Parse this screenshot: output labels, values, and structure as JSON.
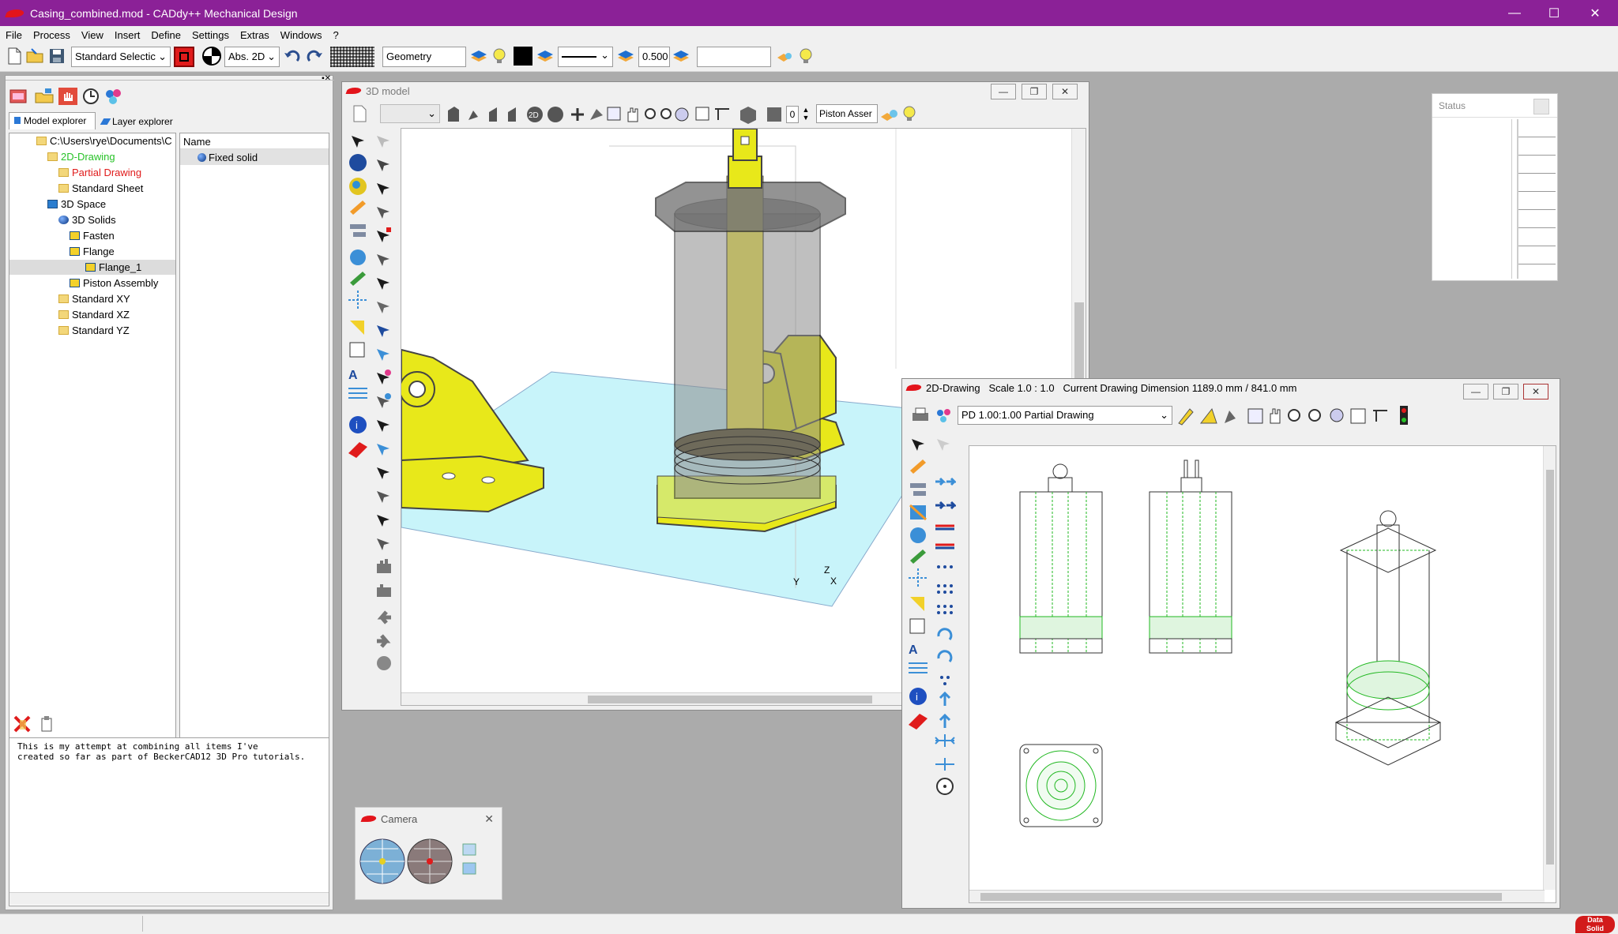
{
  "window": {
    "file_title": "Casing_combined.mod",
    "app_title": "CADdy++ Mechanical Design",
    "title_sep": "-",
    "controls": {
      "minimize": "—",
      "maximize": "☐",
      "close": "✕"
    }
  },
  "menu": [
    "File",
    "Process",
    "View",
    "Insert",
    "Define",
    "Settings",
    "Extras",
    "Windows",
    "?"
  ],
  "toolbar": {
    "selection_mode": "Standard Selectic",
    "coord_mode": "Abs. 2D",
    "layer_field": "Geometry",
    "line_width": "0.500",
    "empty_field": ""
  },
  "left_panel": {
    "tabs": [
      "Model explorer",
      "Layer explorer"
    ],
    "tree": [
      {
        "label": "C:\\Users\\rye\\Documents\\C",
        "level": 0,
        "icon": "folder-open-icon",
        "color": "#000000"
      },
      {
        "label": "2D-Drawing",
        "level": 1,
        "icon": "folder-icon",
        "color": "#27c227"
      },
      {
        "label": "Partial Drawing",
        "level": 2,
        "icon": "folder-icon",
        "color": "#e01b1b"
      },
      {
        "label": "Standard Sheet",
        "level": 2,
        "icon": "folder-icon",
        "color": "#000000"
      },
      {
        "label": "3D Space",
        "level": 1,
        "icon": "space-icon",
        "color": "#000000"
      },
      {
        "label": "3D Solids",
        "level": 2,
        "icon": "sphere-icon",
        "color": "#000000"
      },
      {
        "label": "Fasten",
        "level": 3,
        "icon": "part-icon",
        "color": "#000000"
      },
      {
        "label": "Flange",
        "level": 3,
        "icon": "part-icon",
        "color": "#000000"
      },
      {
        "label": "Flange_1",
        "level": 4,
        "icon": "part-icon",
        "color": "#000000",
        "selected": true
      },
      {
        "label": "Piston Assembly",
        "level": 3,
        "icon": "part-icon",
        "color": "#000000"
      },
      {
        "label": "Standard XY",
        "level": 3,
        "icon": "folder-icon",
        "color": "#000000"
      },
      {
        "label": "Standard XZ",
        "level": 3,
        "icon": "folder-icon",
        "color": "#000000"
      },
      {
        "label": "Standard YZ",
        "level": 3,
        "icon": "folder-icon",
        "color": "#000000"
      }
    ],
    "list_header": "Name",
    "list_items": [
      "Fixed solid"
    ],
    "notes": "This is my attempt at combining all items I've\ncreated so far as part of BeckerCAD12 3D Pro tutorials."
  },
  "window_3d": {
    "title": "3D model",
    "assembly_field": "Piston Asser",
    "count_field": "0",
    "axis_labels": [
      "Z",
      "Y",
      "X"
    ]
  },
  "window_2d": {
    "title_prefix": "2D-Drawing",
    "scale": "Scale 1.0 : 1.0",
    "dimension": "Current Drawing Dimension 1189.0 mm / 841.0 mm",
    "sheet_select": "PD 1.00:1.00 Partial Drawing"
  },
  "status_panel": {
    "title": "Status"
  },
  "camera_panel": {
    "title": "Camera"
  },
  "colors": {
    "title_bar": "#8b2197",
    "part_yellow": "#e8e81a",
    "wireframe_green": "#22b822",
    "ground_cyan": "#c8f4fa"
  }
}
